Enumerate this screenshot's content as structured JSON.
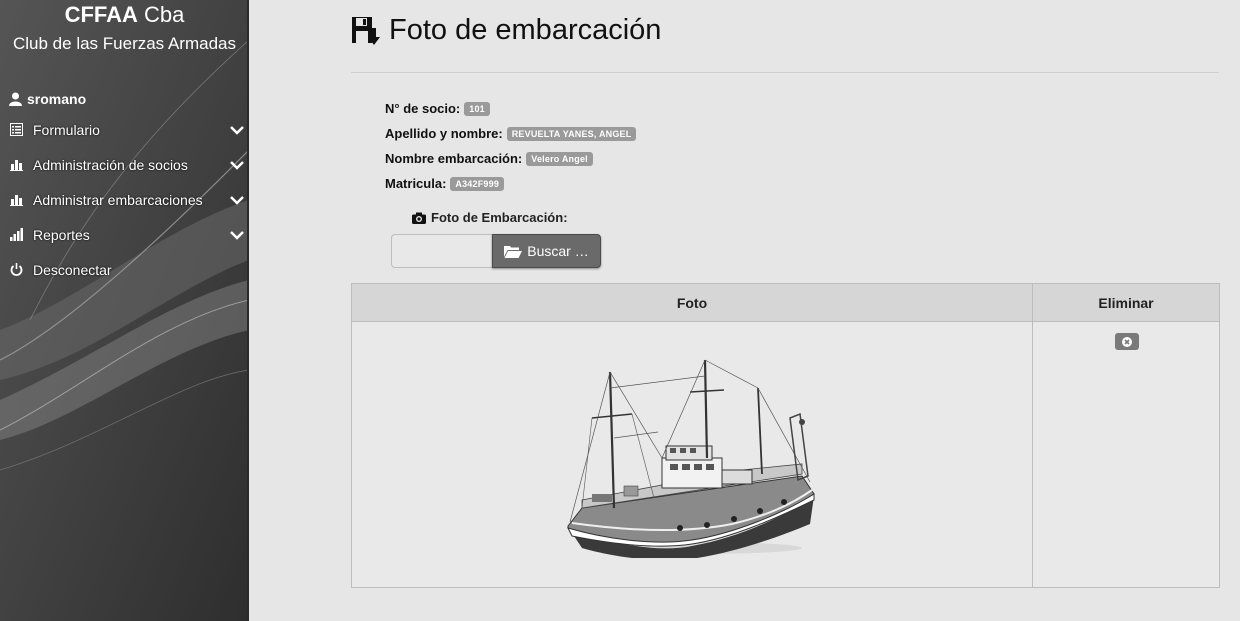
{
  "brand": {
    "title_bold": "CFFAA",
    "title_rest": " Cba",
    "subtitle": "Club de las Fuerzas Armadas"
  },
  "sidebar": {
    "user": "sromano",
    "items": [
      {
        "label": "Formulario",
        "icon": "list-icon",
        "has_chevron": true
      },
      {
        "label": "Administración de socios",
        "icon": "bar-chart-icon",
        "has_chevron": true
      },
      {
        "label": "Administrar embarcaciones",
        "icon": "bar-chart-icon",
        "has_chevron": true
      },
      {
        "label": "Reportes",
        "icon": "signal-icon",
        "has_chevron": true
      },
      {
        "label": "Desconectar",
        "icon": "power-icon",
        "has_chevron": false
      }
    ]
  },
  "page": {
    "title": "Foto de embarcación",
    "title_icon": "save-download-icon"
  },
  "info": {
    "socio_label": "N° de socio:",
    "socio_value": "101",
    "nombre_label": "Apellido y nombre:",
    "nombre_value": "REVUELTA YANES, ANGEL",
    "embarcacion_label": "Nombre embarcación:",
    "embarcacion_value": "Velero Angel",
    "matricula_label": "Matricula:",
    "matricula_value": "A342F999"
  },
  "upload": {
    "label": "Foto de Embarcación:",
    "file_value": "",
    "browse_label": "Buscar …"
  },
  "table": {
    "col_foto": "Foto",
    "col_eliminar": "Eliminar"
  },
  "colors": {
    "sidebar_bg": "#3a3a3a",
    "page_bg": "#e6e6e6",
    "badge_bg": "#9a9a9a",
    "button_bg": "#6a6a6a"
  }
}
